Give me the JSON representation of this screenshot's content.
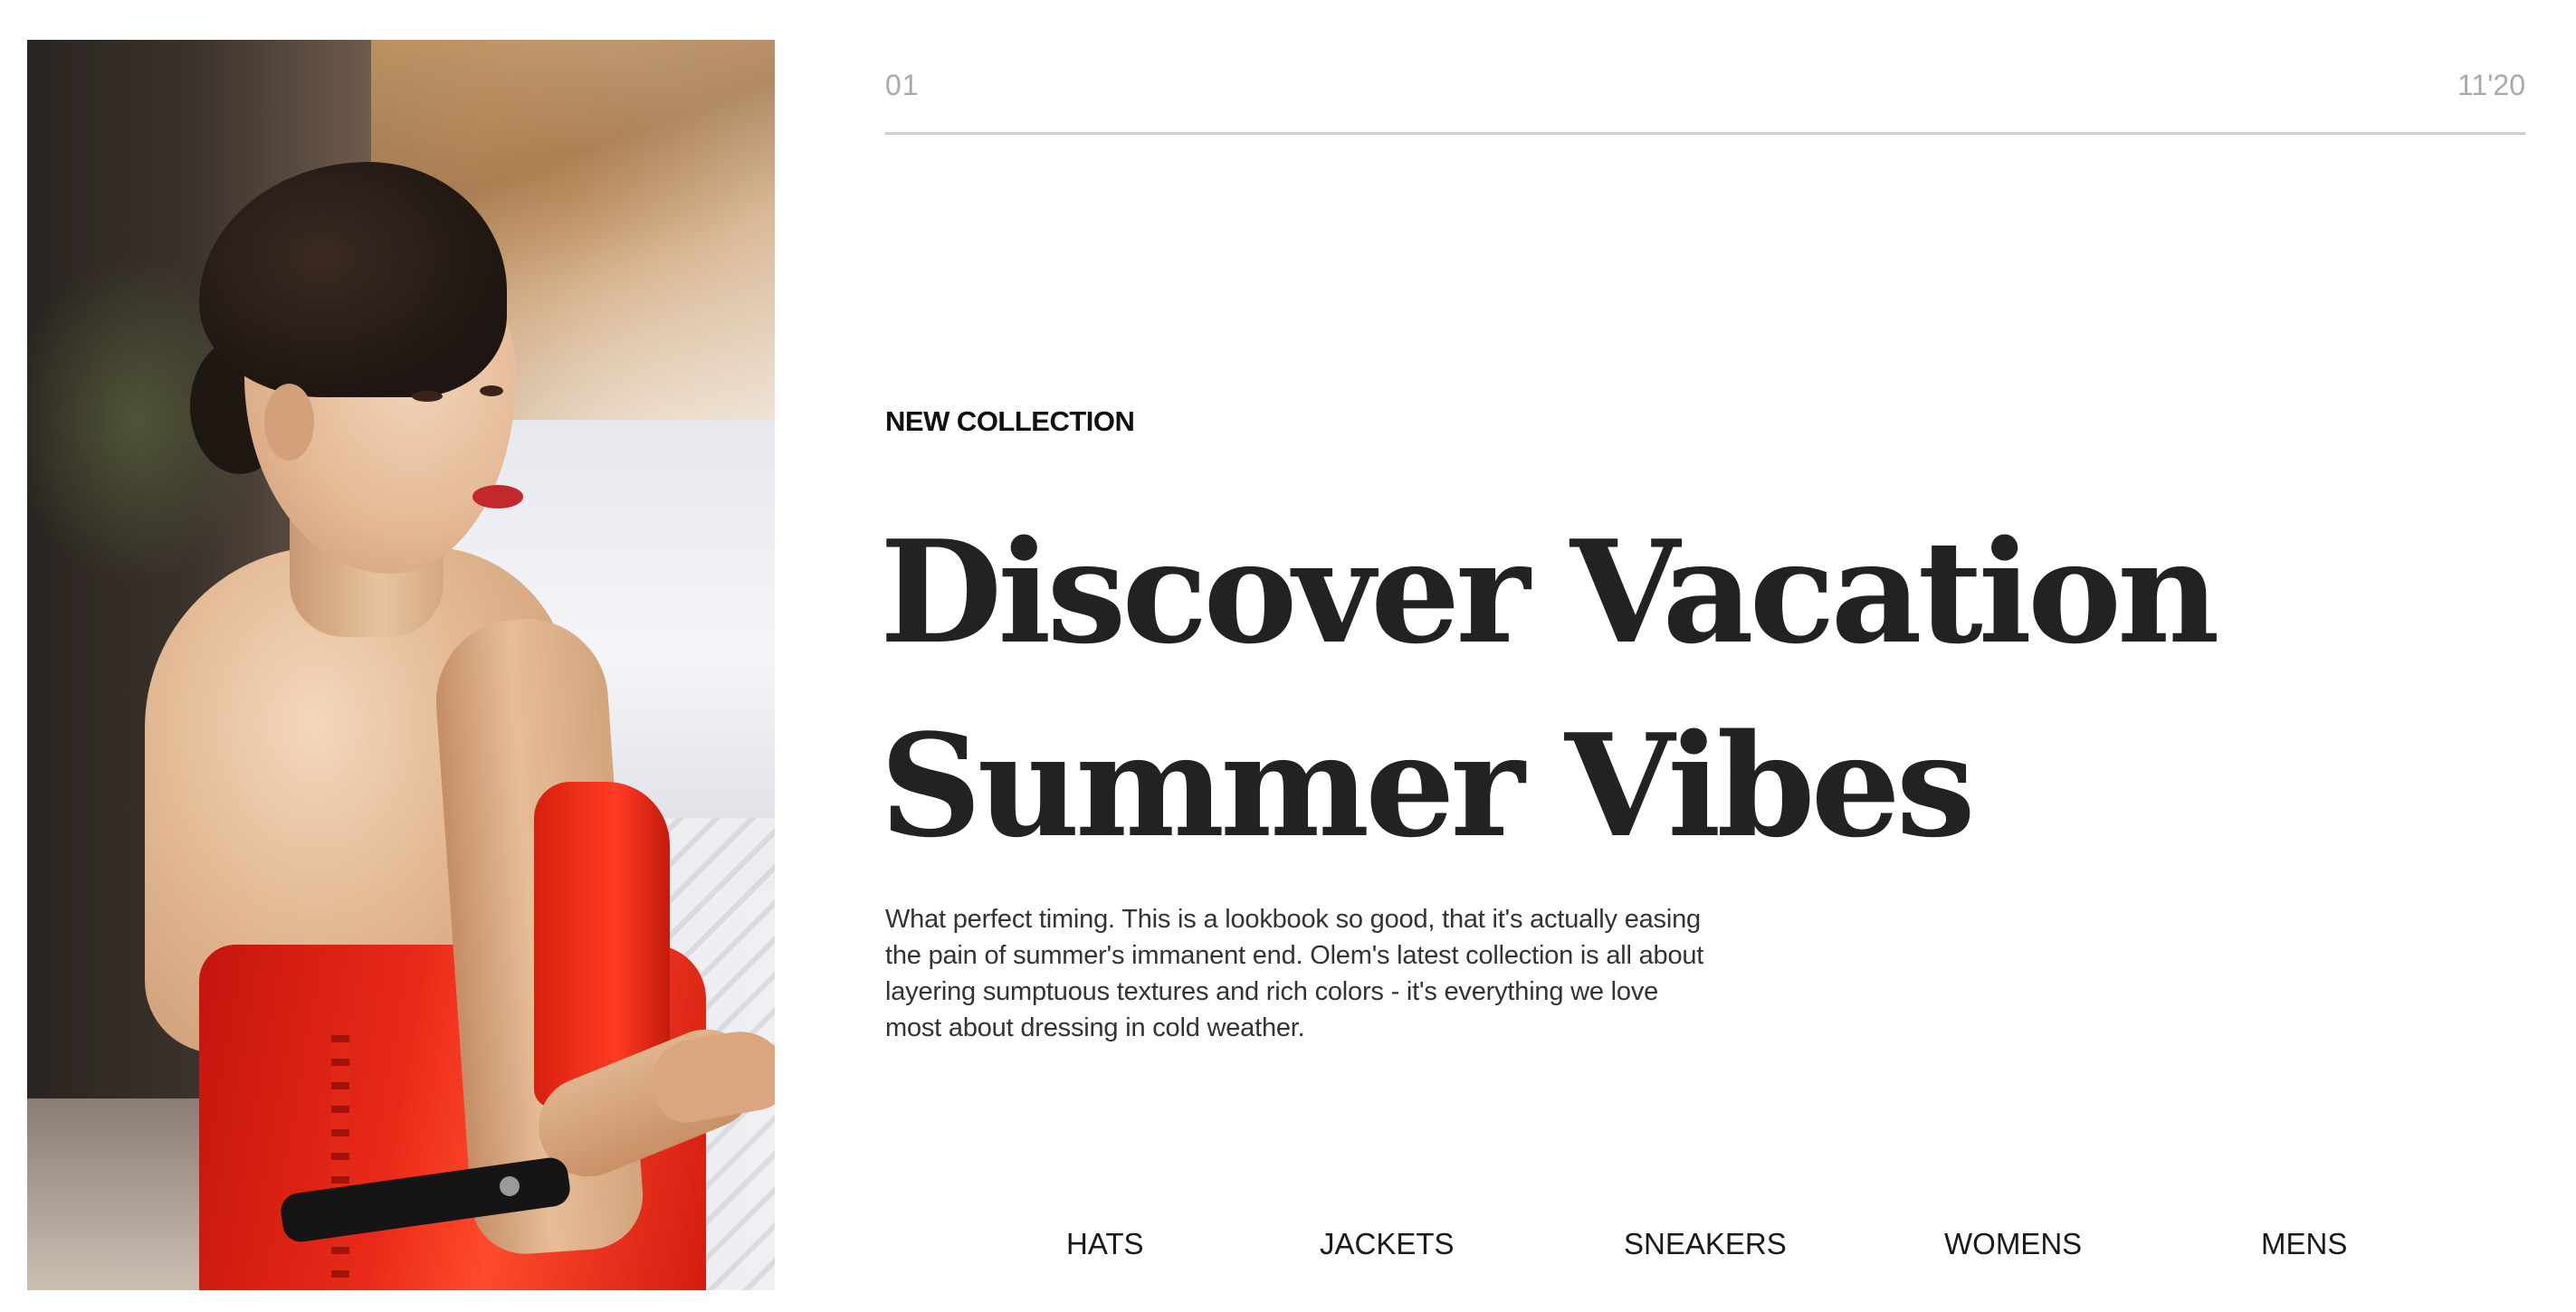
{
  "meta": {
    "index": "01",
    "date": "11'20"
  },
  "hero": {
    "eyebrow": "NEW COLLECTION",
    "headline_line1": "Discover Vacation",
    "headline_line2": "Summer Vibes",
    "description": "What perfect timing. This is a lookbook so good, that it's actually easing the pain of summer's immanent end. Olem's latest collection is all about layering sumptuous textures and rich colors - it's everything we love most about dressing in cold weather."
  },
  "categories": [
    {
      "label": "HATS"
    },
    {
      "label": "JACKETS"
    },
    {
      "label": "SNEAKERS"
    },
    {
      "label": "WOMENS"
    },
    {
      "label": "MENS"
    }
  ],
  "colors": {
    "text": "#222222",
    "muted": "#a9a9a9",
    "rule": "#cfcfcf",
    "dress": "#e8261a",
    "background": "#ffffff"
  }
}
